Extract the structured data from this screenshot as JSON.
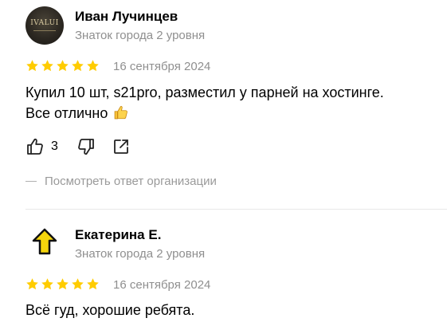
{
  "reviews": [
    {
      "author": "Иван Лучинцев",
      "level": "Знаток города 2 уровня",
      "avatar_text": "IVALUI",
      "rating": 5,
      "date": "16 сентября 2024",
      "text_line1": "Купил 10 шт, s21pro, разместил у парней на хостинге.",
      "text_line2": "Все отлично",
      "likes": "3",
      "reply_link": "Посмотреть ответ организации",
      "icons": [
        "like-icon",
        "dislike-icon",
        "share-icon",
        "thumbs-up-emoji"
      ]
    },
    {
      "author": "Екатерина Е.",
      "level": "Знаток города 2 уровня",
      "rating": 5,
      "date": "16 сентября 2024",
      "text": "Всё гуд, хорошие ребята.",
      "icons": [
        "arrow-up-icon"
      ]
    }
  ],
  "colors": {
    "star": "#fc0",
    "muted": "#8f8f8f",
    "arrow_fill": "#f5d50c"
  }
}
